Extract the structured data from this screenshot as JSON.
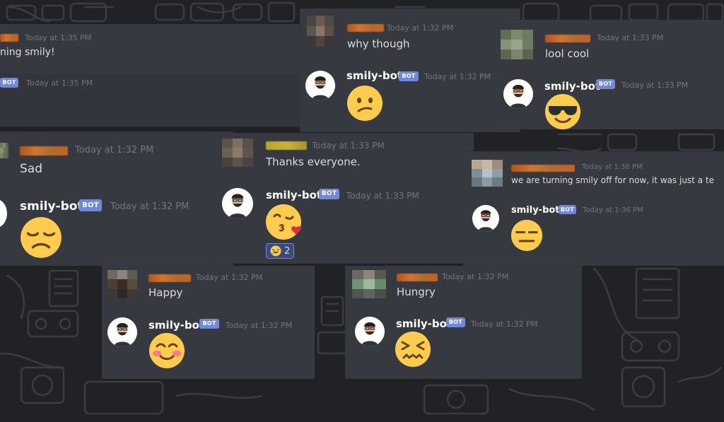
{
  "bot": {
    "name": "smily-bot",
    "badge": "BOT"
  },
  "colors": {
    "bot_badge": "#7289da",
    "card_bg": "#36393f",
    "page_bg": "#202225",
    "emoji_yellow": "#ffcc4d"
  },
  "cards": {
    "c1": {
      "user_time": "Today at 1:35 PM",
      "user_text": "ning smily!",
      "bot_time": "Today at 1:35 PM"
    },
    "c2": {
      "user_time": "Today at 1:32 PM",
      "user_text": "why though",
      "bot_time": "Today at 1:32 PM",
      "emoji": "confused-face"
    },
    "c3": {
      "user_time": "Today at 1:33 PM",
      "user_text": "lool cool",
      "bot_time": "Today at 1:33 PM",
      "emoji": "sunglasses-face"
    },
    "c4": {
      "user_time": "Today at 1:32 PM",
      "user_text": "Sad",
      "bot_time": "Today at 1:32 PM",
      "emoji": "unamused-face"
    },
    "c5": {
      "user_time": "Today at 1:33 PM",
      "user_text": "Thanks everyone.",
      "bot_time": "Today at 1:33 PM",
      "emoji": "kissing-heart-face",
      "reaction_count": "2"
    },
    "c6": {
      "user_time": "Today at 1:36 PM",
      "user_text": "we are turning smily off for now, it was just a te",
      "bot_time": "Today at 1:36 PM",
      "emoji": "expressionless-face"
    },
    "c7": {
      "user_time": "Today at 1:32 PM",
      "user_text": "Happy",
      "bot_time": "Today at 1:32 PM",
      "emoji": "blushing-face"
    },
    "c8": {
      "user_time": "Today at 1:32 PM",
      "user_text": "Hungry",
      "bot_time": "Today at 1:32 PM",
      "emoji": "confounded-face"
    }
  }
}
